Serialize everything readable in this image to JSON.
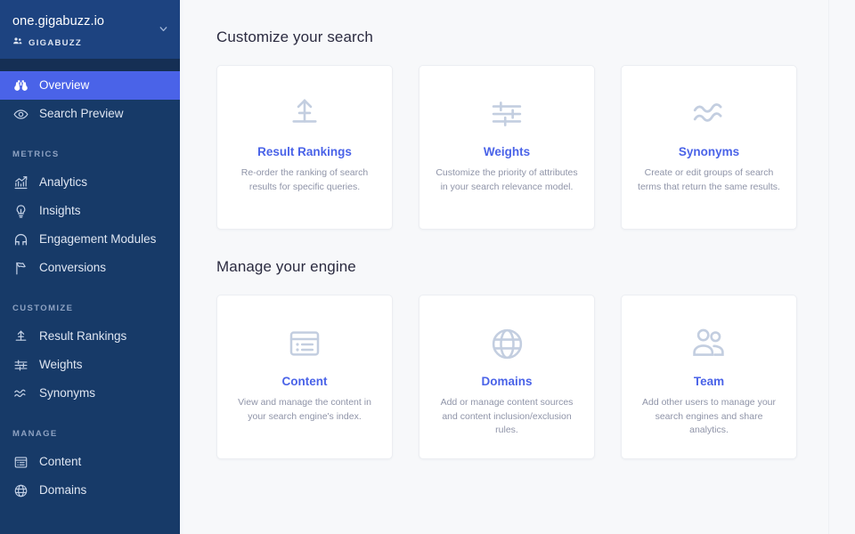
{
  "sidebar": {
    "org_name": "one.gigabuzz.io",
    "org_sub_label": "GIGABUZZ",
    "org_icon": "people-icon",
    "chevron_icon": "chevron-down-icon",
    "top_items": [
      {
        "label": "Overview",
        "icon": "binoculars-icon",
        "active": true
      },
      {
        "label": "Search Preview",
        "icon": "eye-icon",
        "active": false
      }
    ],
    "sections": [
      {
        "title": "METRICS",
        "items": [
          {
            "label": "Analytics",
            "icon": "chart-growth-icon"
          },
          {
            "label": "Insights",
            "icon": "lightbulb-icon"
          },
          {
            "label": "Engagement Modules",
            "icon": "magnet-icon"
          },
          {
            "label": "Conversions",
            "icon": "flag-icon"
          }
        ]
      },
      {
        "title": "CUSTOMIZE",
        "items": [
          {
            "label": "Result Rankings",
            "icon": "rankings-icon"
          },
          {
            "label": "Weights",
            "icon": "sliders-icon"
          },
          {
            "label": "Synonyms",
            "icon": "waves-icon"
          }
        ]
      },
      {
        "title": "MANAGE",
        "items": [
          {
            "label": "Content",
            "icon": "content-window-icon"
          },
          {
            "label": "Domains",
            "icon": "globe-icon"
          }
        ]
      }
    ]
  },
  "main": {
    "sections": [
      {
        "title": "Customize your search",
        "cards": [
          {
            "icon": "rankings-icon",
            "title": "Result Rankings",
            "desc": "Re-order the ranking of search results for specific queries."
          },
          {
            "icon": "sliders-icon",
            "title": "Weights",
            "desc": "Customize the priority of attributes in your search relevance model."
          },
          {
            "icon": "waves-icon",
            "title": "Synonyms",
            "desc": "Create or edit groups of search terms that return the same results."
          }
        ]
      },
      {
        "title": "Manage your engine",
        "cards": [
          {
            "icon": "content-window-icon",
            "title": "Content",
            "desc": "View and manage the content in your search engine's index."
          },
          {
            "icon": "globe-icon",
            "title": "Domains",
            "desc": "Add or manage content sources and content inclusion/exclusion rules."
          },
          {
            "icon": "people-icon",
            "title": "Team",
            "desc": "Add other users to manage your search engines and share analytics."
          }
        ]
      }
    ]
  },
  "colors": {
    "sidebar_bg": "#173a68",
    "sidebar_header_bg": "#1d4380",
    "accent": "#4a63e8",
    "page_bg": "#f7f8fa",
    "card_bg": "#ffffff",
    "icon_muted": "#c3cee0"
  }
}
